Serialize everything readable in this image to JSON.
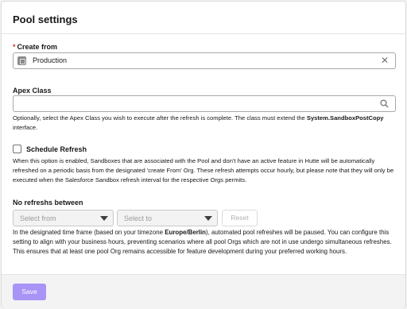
{
  "page_title": "Pool settings",
  "create_from": {
    "label": "Create from",
    "required_marker": "*",
    "value": "Production"
  },
  "apex_class": {
    "label": "Apex Class",
    "value": "",
    "help_1": "Optionally, select the Apex Class you wish to execute after the refresh is complete. The class must extend the ",
    "help_code": "System.SandboxPostCopy",
    "help_2": " interface."
  },
  "schedule_refresh": {
    "label": "Schedule Refresh",
    "checked": false,
    "help": "When this option is enabled, Sandboxes that are associated with the Pool and don't have an active feature in Hutte will be automatically refreshed on a periodic basis from the designated 'create From' Org. These refresh attempts occur hourly, but please note that they will only be executed when the Salesforce Sandbox refresh interval for the respective Orgs permits."
  },
  "no_refresh": {
    "label": "No refreshs between",
    "select_from_placeholder": "Select from",
    "select_to_placeholder": "Select to",
    "reset_label": "Reset",
    "help_1": "In the designated time frame (based on your timezone ",
    "help_timezone": "Europe/Berlin",
    "help_2": "), automated pool refreshes will be paused. You can configure this setting to align with your business hours, preventing scenarios where all pool Orgs which are not in use undergo simultaneous refreshes. This ensures that at least one pool Org remains accessible for feature development during your preferred working hours."
  },
  "footer": {
    "save_label": "Save"
  },
  "colors": {
    "accent_disabled": "#a893f6",
    "required": "#c23934"
  }
}
